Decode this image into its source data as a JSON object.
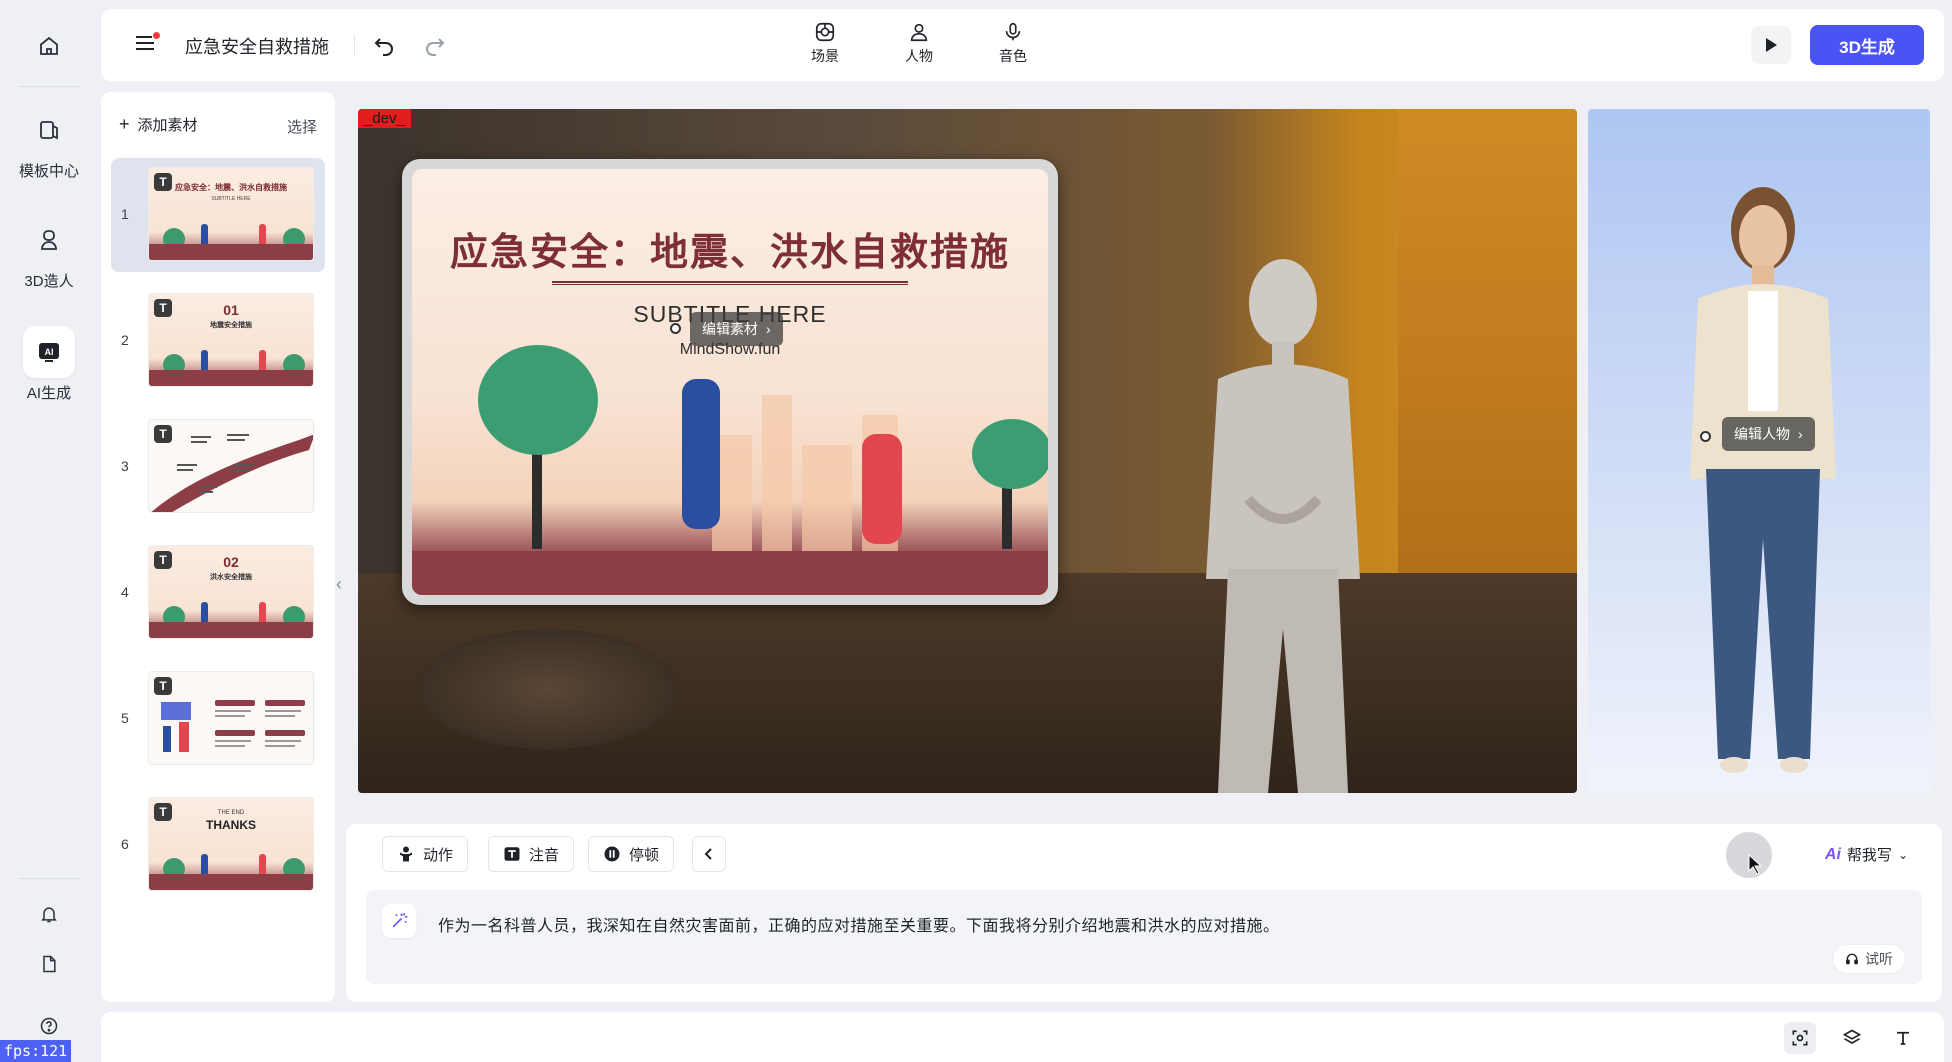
{
  "rail": {
    "items": [
      {
        "label": "",
        "icon": "home-icon"
      },
      {
        "label": "模板中心",
        "icon": "template-icon"
      },
      {
        "label": "3D造人",
        "icon": "avatar-3d-icon"
      },
      {
        "label": "AI生成",
        "icon": "ai-icon"
      }
    ],
    "fps": "fps:121"
  },
  "topbar": {
    "doc_title": "应急安全自救措施",
    "tabs": [
      {
        "label": "场景",
        "icon": "scene-icon"
      },
      {
        "label": "人物",
        "icon": "person-icon"
      },
      {
        "label": "音色",
        "icon": "microphone-icon"
      }
    ],
    "generate_label": "3D生成"
  },
  "slides": {
    "add_label": "添加素材",
    "select_label": "选择",
    "items": [
      {
        "num": "1",
        "title": "应急安全：地震、洪水自救措施",
        "sub": "SUBTITLE HERE"
      },
      {
        "num": "2",
        "title": "01",
        "sub": "地震安全措施"
      },
      {
        "num": "3",
        "title": "",
        "sub": ""
      },
      {
        "num": "4",
        "title": "02",
        "sub": "洪水安全措施"
      },
      {
        "num": "5",
        "title": "",
        "sub": ""
      },
      {
        "num": "6",
        "title": "THANKS",
        "sub": "THE END"
      }
    ]
  },
  "stage": {
    "dev_tag": "_dev_",
    "slide_title": "应急安全：地震、洪水自救措施",
    "slide_subtitle": "SUBTITLE HERE",
    "slide_brand": "MindShow.fun",
    "edit_material_label": "编辑素材"
  },
  "preview": {
    "edit_person_label": "编辑人物"
  },
  "editor": {
    "tools": [
      {
        "label": "动作",
        "icon": "action-icon"
      },
      {
        "label": "注音",
        "icon": "pinyin-icon"
      },
      {
        "label": "停顿",
        "icon": "pause-icon"
      }
    ],
    "ai_write_label": "帮我写",
    "script_text": "作为一名科普人员，我深知在自然灾害面前，正确的应对措施至关重要。下面我将分别介绍地震和洪水的应对措施。",
    "listen_label": "试听"
  },
  "colors": {
    "accent": "#4b53f5",
    "slide_maroon": "#7d2f35",
    "ai_purple": "#7b57f0"
  }
}
